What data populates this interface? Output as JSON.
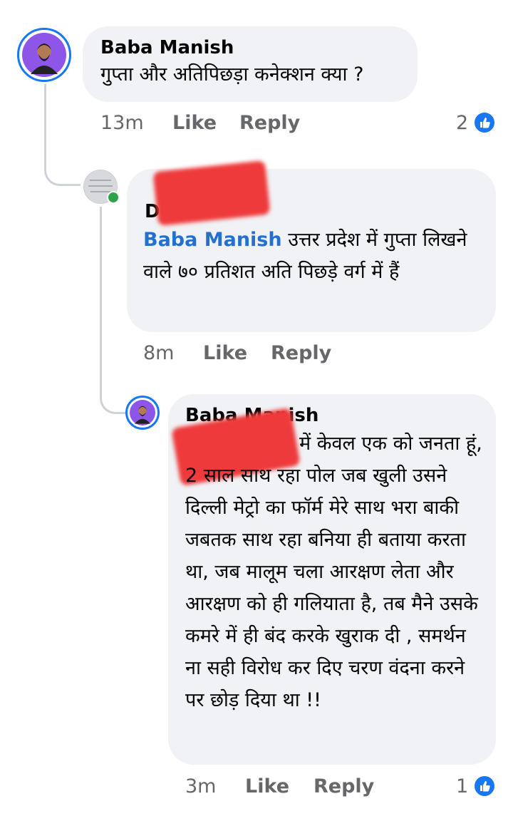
{
  "comments": [
    {
      "author": "Baba Manish",
      "text": "गुप्ता और अतिपिछड़ा कनेक्शन क्या ?",
      "time": "13m",
      "like_label": "Like",
      "reply_label": "Reply",
      "reaction_count": "2"
    },
    {
      "author_visible": "D",
      "mention": "Baba Manish",
      "text": " उत्तर प्रदेश में गुप्ता लिखने वाले ७० प्रतिशत अति पिछड़े वर्ग में हैं",
      "time": "8m",
      "like_label": "Like",
      "reply_label": "Reply"
    },
    {
      "author": "Baba Manish",
      "text": "में केवल एक को जनता हूं, 2 साल साथ रहा पोल जब खुली उसने दिल्ली मेट्रो का फॉर्म मेरे साथ भरा बाकी जबतक साथ रहा बनिया ही बताया करता था, जब मालूम चला आरक्षण लेता और आरक्षण को ही गलियाता है, तब मैने उसके कमरे में ही बंद करके खुराक दी , समर्थन ना सही विरोध कर दिए चरण वंदना करने पर छोड़ दिया था !!",
      "time": "3m",
      "like_label": "Like",
      "reply_label": "Reply",
      "reaction_count": "1"
    }
  ],
  "colors": {
    "bubble": "#f0f2f5",
    "mention": "#2470d1",
    "meta": "#65676b",
    "like": "#1877f2",
    "avatar_ring": "#1877f2",
    "redaction": "#ee3a3a"
  }
}
